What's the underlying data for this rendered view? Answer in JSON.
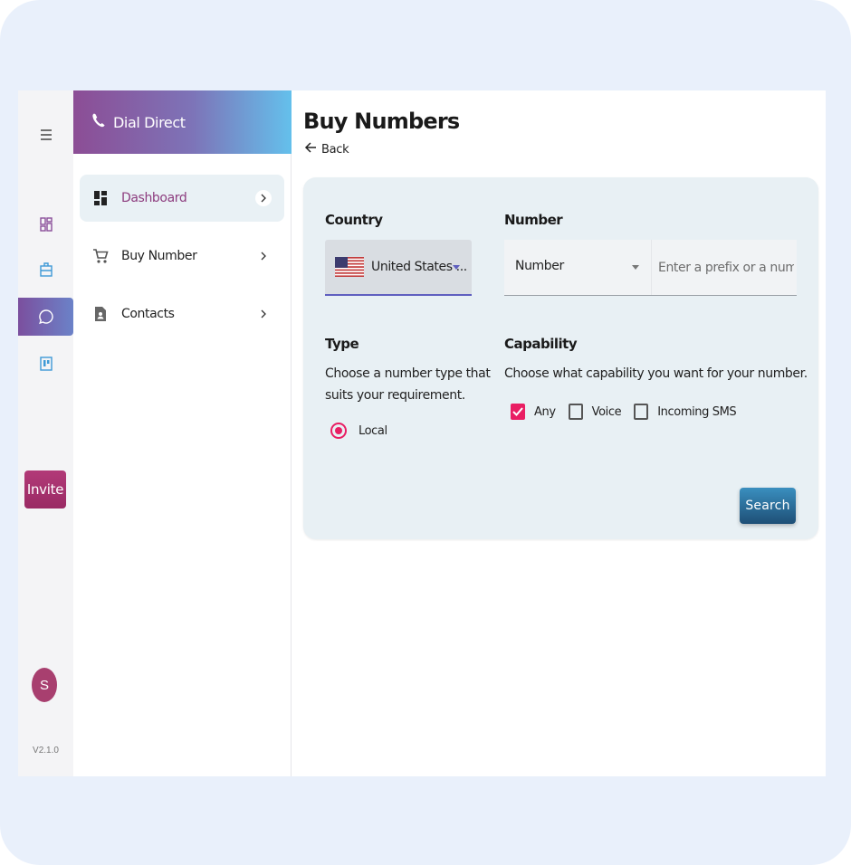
{
  "rail": {
    "items": [
      {
        "icon": "menu-icon"
      },
      {
        "icon": "dashboard-grid-icon"
      },
      {
        "icon": "briefcase-icon"
      },
      {
        "icon": "chat-bubble-icon"
      },
      {
        "icon": "board-icon"
      }
    ],
    "invite_label": "Invite",
    "avatar_initial": "S",
    "version": "V2.1.0"
  },
  "sidebar": {
    "brand_title": "Dial Direct",
    "items": [
      {
        "label": "Dashboard",
        "icon": "dashboard-icon"
      },
      {
        "label": "Buy Number",
        "icon": "cart-icon"
      },
      {
        "label": "Contacts",
        "icon": "contact-card-icon"
      }
    ]
  },
  "main": {
    "title": "Buy Numbers",
    "back_label": "Back",
    "country": {
      "label": "Country",
      "value": "United States ..."
    },
    "number": {
      "label": "Number",
      "type_value": "Number",
      "placeholder": "Enter a prefix or a number"
    },
    "type": {
      "label": "Type",
      "description_line1": "Choose a number type that",
      "description_line2": "suits your requirement.",
      "option_label": "Local"
    },
    "capability": {
      "label": "Capability",
      "description": "Choose what capability you want for your number.",
      "options": [
        {
          "label": "Any",
          "checked": true
        },
        {
          "label": "Voice",
          "checked": false
        },
        {
          "label": "Incoming SMS",
          "checked": false
        }
      ]
    },
    "search_label": "Search"
  },
  "colors": {
    "accent_pink": "#e91e63",
    "brand_purple": "#8d3d7f",
    "invite_bg": "#a8326e"
  }
}
